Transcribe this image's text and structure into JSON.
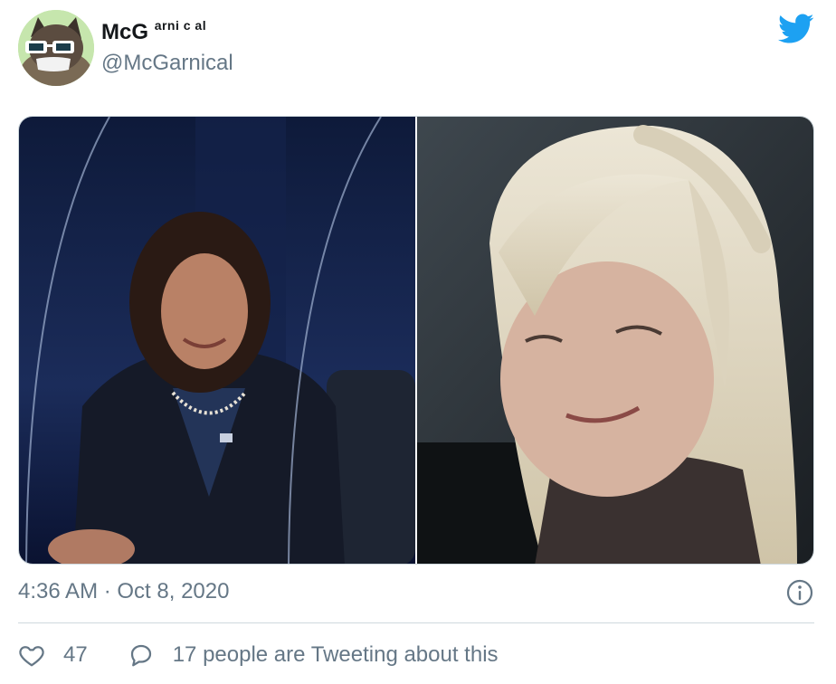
{
  "author": {
    "display_name": "McG",
    "display_name_suffix": "arni c al",
    "handle": "@McGarnical",
    "avatar_icon": "cat-with-sunglasses-avatar"
  },
  "brand": {
    "icon": "twitter-bird-icon",
    "color": "#1da1f2"
  },
  "media": {
    "image_count": 2
  },
  "meta": {
    "timestamp": "4:36 AM · Oct 8, 2020",
    "info_icon": "info-icon"
  },
  "actions": {
    "like_count": "47",
    "replies_text": "17 people are Tweeting about this"
  },
  "colors": {
    "secondary_text": "#657786",
    "primary_text": "#14171a",
    "divider": "#cfd9de"
  }
}
